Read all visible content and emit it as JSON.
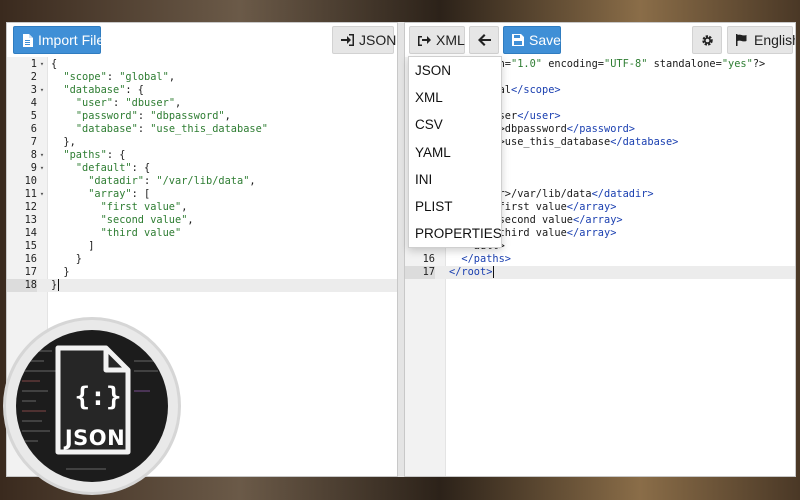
{
  "left_toolbar": {
    "import_label": "Import File",
    "json_label": "JSON"
  },
  "right_toolbar": {
    "xml_label": "XML",
    "save_label": "Save",
    "language_label": "English"
  },
  "format_menu": {
    "items": [
      "JSON",
      "XML",
      "CSV",
      "YAML",
      "INI",
      "PLIST",
      "PROPERTIES"
    ]
  },
  "left_editor": {
    "lines": [
      {
        "n": "1",
        "fold": true,
        "code": "{"
      },
      {
        "n": "2",
        "fold": false,
        "code": "  \"scope\": \"global\","
      },
      {
        "n": "3",
        "fold": true,
        "code": "  \"database\": {"
      },
      {
        "n": "4",
        "fold": false,
        "code": "    \"user\": \"dbuser\","
      },
      {
        "n": "5",
        "fold": false,
        "code": "    \"password\": \"dbpassword\","
      },
      {
        "n": "6",
        "fold": false,
        "code": "    \"database\": \"use_this_database\""
      },
      {
        "n": "7",
        "fold": false,
        "code": "  },"
      },
      {
        "n": "8",
        "fold": true,
        "code": "  \"paths\": {"
      },
      {
        "n": "9",
        "fold": true,
        "code": "    \"default\": {"
      },
      {
        "n": "10",
        "fold": false,
        "code": "      \"datadir\": \"/var/lib/data\","
      },
      {
        "n": "11",
        "fold": true,
        "code": "      \"array\": ["
      },
      {
        "n": "12",
        "fold": false,
        "code": "        \"first value\","
      },
      {
        "n": "13",
        "fold": false,
        "code": "        \"second value\","
      },
      {
        "n": "14",
        "fold": false,
        "code": "        \"third value\""
      },
      {
        "n": "15",
        "fold": false,
        "code": "      ]"
      },
      {
        "n": "16",
        "fold": false,
        "code": "    }"
      },
      {
        "n": "17",
        "fold": false,
        "code": "  }"
      },
      {
        "n": "18",
        "fold": false,
        "code": "}",
        "active": true
      }
    ]
  },
  "right_editor": {
    "lines": [
      {
        "n": "",
        "code": "    rsion=\"1.0\" encoding=\"UTF-8\" standalone=\"yes\"?>"
      },
      {
        "n": "",
        "code": ""
      },
      {
        "n": "",
        "code": "    global</scope>"
      },
      {
        "n": "",
        "code": "    se>"
      },
      {
        "n": "",
        "code": "    >dbuser</user>"
      },
      {
        "n": "",
        "code": "    word>dbpassword</password>"
      },
      {
        "n": "",
        "code": "    base>use_this_database</database>"
      },
      {
        "n": "",
        "code": "    se>"
      },
      {
        "n": "",
        "code": ""
      },
      {
        "n": "",
        "code": "    ult>"
      },
      {
        "n": "",
        "code": "    tadir>/var/lib/data</datadir>"
      },
      {
        "n": "",
        "code": "    ray>first value</array>"
      },
      {
        "n": "",
        "code": "    ray>second value</array>"
      },
      {
        "n": "",
        "code": "    ray>third value</array>"
      },
      {
        "n": "",
        "code": "    ault>"
      },
      {
        "n": "16",
        "code": "  </paths>"
      },
      {
        "n": "17",
        "code": "</root>",
        "active": true
      }
    ]
  },
  "logo": {
    "text": "JSON",
    "glyph": "{:}"
  },
  "colors": {
    "primary": "#3f8fd6",
    "json_string": "#2e7d32",
    "xml_tag": "#1a3fb0"
  }
}
